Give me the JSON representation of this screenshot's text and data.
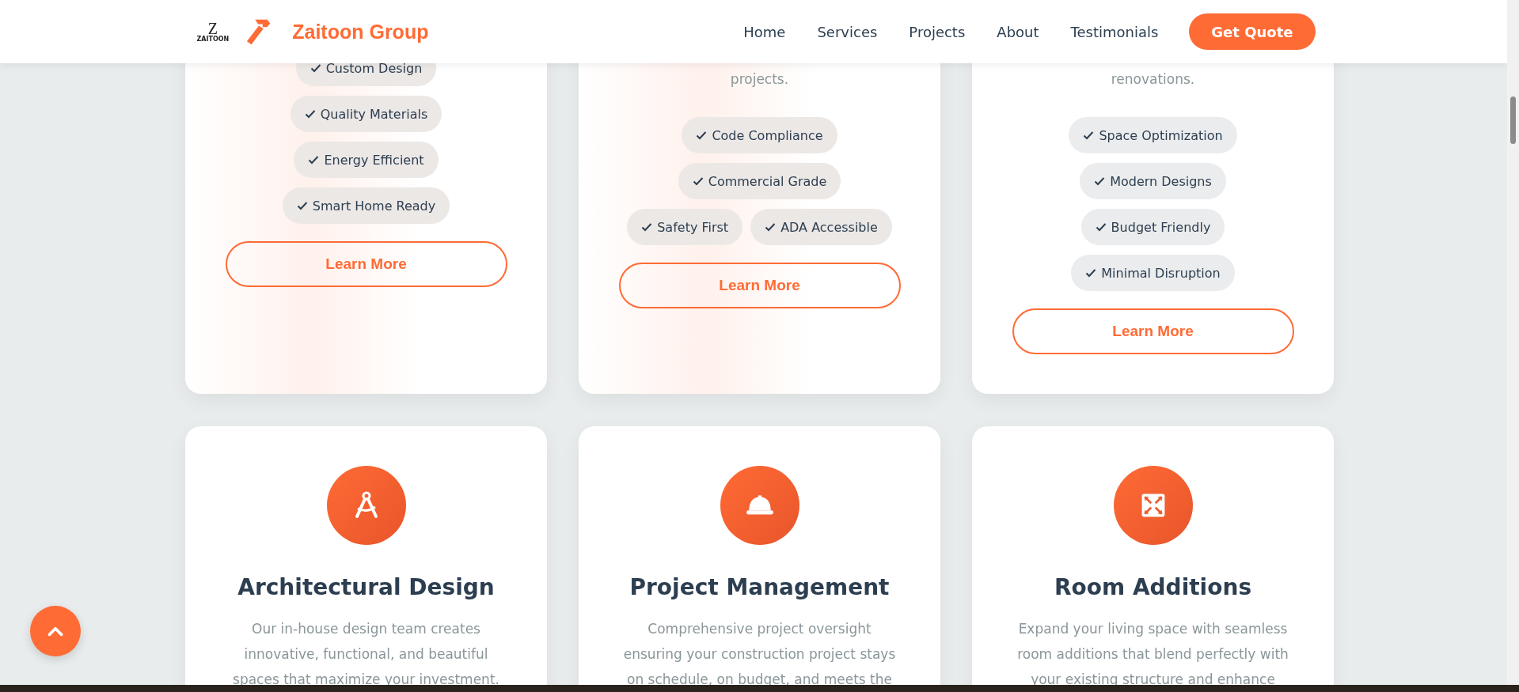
{
  "header": {
    "logo_mark": {
      "letter": "Z",
      "caption": "ZAITOON"
    },
    "brand": "Zaitoon Group",
    "nav": [
      {
        "label": "Home"
      },
      {
        "label": "Services"
      },
      {
        "label": "Projects"
      },
      {
        "label": "About"
      },
      {
        "label": "Testimonials"
      }
    ],
    "cta": "Get Quote"
  },
  "service_cards_top": [
    {
      "highlighted": true,
      "feature_rows": [
        [
          "Custom Design"
        ],
        [
          "Quality Materials"
        ],
        [
          "Energy Efficient"
        ],
        [
          "Smart Home Ready"
        ]
      ],
      "button": "Learn More"
    },
    {
      "highlighted": true,
      "description_end": "projects.",
      "feature_rows": [
        [
          "Code Compliance"
        ],
        [
          "Commercial Grade"
        ],
        [
          "Safety First",
          "ADA Accessible"
        ]
      ],
      "button": "Learn More"
    },
    {
      "highlighted": false,
      "description_end": "renovations.",
      "feature_rows": [
        [
          "Space Optimization"
        ],
        [
          "Modern Designs"
        ],
        [
          "Budget Friendly"
        ],
        [
          "Minimal Disruption"
        ]
      ],
      "button": "Learn More"
    }
  ],
  "service_cards": [
    {
      "kind": "compass",
      "title": "Architectural Design",
      "description_lines": [
        "Our in-house design team creates",
        "innovative, functional, and beautiful",
        "spaces that maximize your investment."
      ]
    },
    {
      "kind": "hardhat",
      "title": "Project Management",
      "description_lines": [
        "Comprehensive project oversight",
        "ensuring your construction project stays",
        "on schedule, on budget, and meets the"
      ]
    },
    {
      "kind": "expand",
      "title": "Room Additions",
      "description_lines": [
        "Expand your living space with seamless",
        "room additions that blend perfectly with",
        "your existing structure and enhance"
      ]
    }
  ]
}
